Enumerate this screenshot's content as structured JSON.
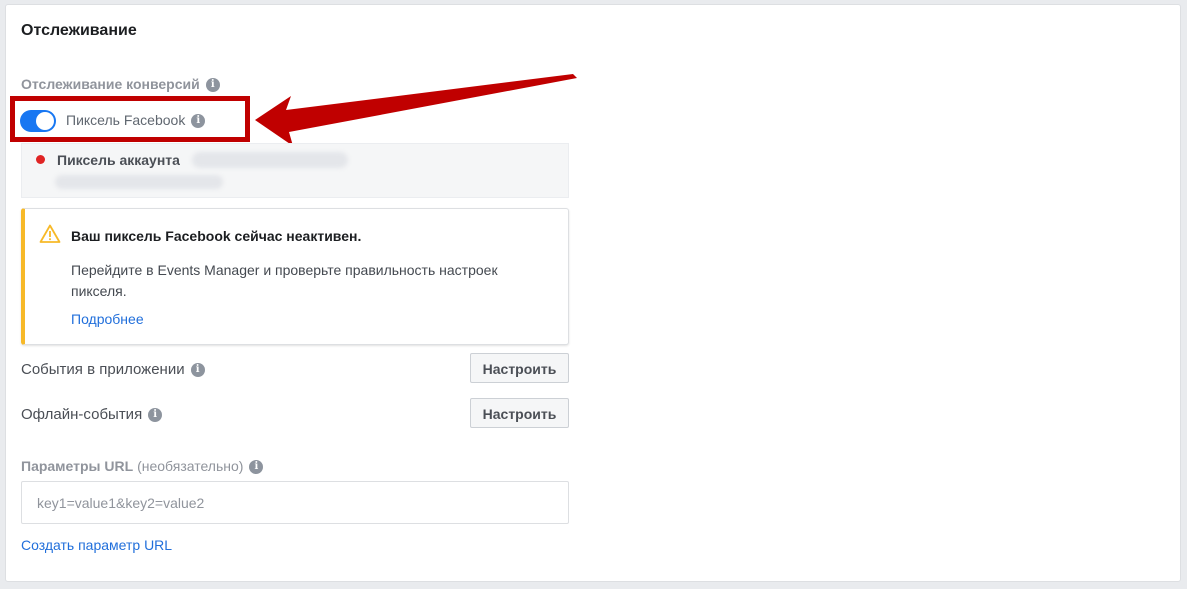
{
  "section": {
    "title": "Отслеживание",
    "conversion_tracking_label": "Отслеживание конверсий"
  },
  "pixel": {
    "toggle_label": "Пиксель Facebook",
    "toggle_on": true,
    "account_label": "Пиксель аккаунта",
    "status_color": "#e02424"
  },
  "warning": {
    "title": "Ваш пиксель Facebook сейчас неактивен.",
    "body": "Перейдите в Events Manager и проверьте правильность настроек пикселя.",
    "link": "Подробнее",
    "accent_color": "#f7b928"
  },
  "app_events": {
    "label": "События в приложении",
    "button": "Настроить"
  },
  "offline_events": {
    "label": "Офлайн-события",
    "button": "Настроить"
  },
  "url_params": {
    "label_bold": "Параметры URL",
    "label_optional": "(необязательно)",
    "placeholder": "key1=value1&key2=value2",
    "create_link": "Создать параметр URL"
  },
  "icons": {
    "info": "i",
    "warning": "warning-triangle-icon"
  },
  "colors": {
    "accent": "#1877f2",
    "link": "#216fdb",
    "annotation": "#c00000"
  }
}
